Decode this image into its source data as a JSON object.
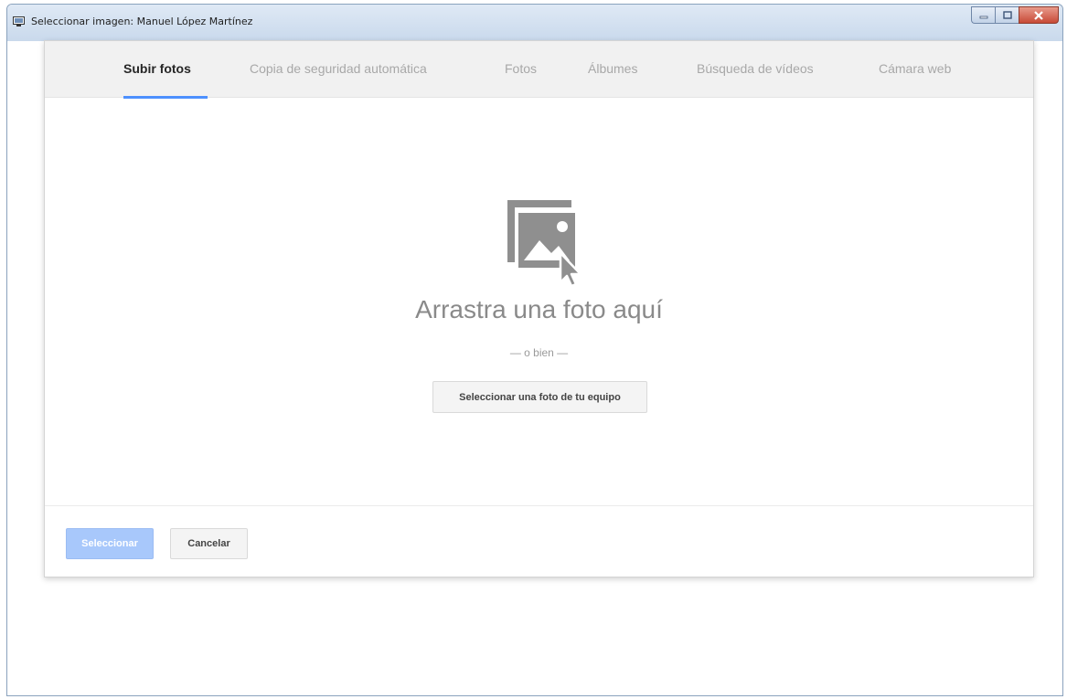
{
  "window": {
    "title": "Seleccionar imagen: Manuel López Martínez"
  },
  "tabs": [
    {
      "label": "Subir fotos",
      "active": true
    },
    {
      "label": "Copia de seguridad automática",
      "active": false
    },
    {
      "label": "Fotos",
      "active": false
    },
    {
      "label": "Álbumes",
      "active": false
    },
    {
      "label": "Búsqueda de vídeos",
      "active": false
    },
    {
      "label": "Cámara web",
      "active": false
    }
  ],
  "upload": {
    "icon": "photo-drop-icon",
    "drop_text": "Arrastra una foto aquí",
    "or_text": "— o bien —",
    "select_button": "Seleccionar una foto de tu equipo"
  },
  "footer": {
    "select_label": "Seleccionar",
    "cancel_label": "Cancelar"
  },
  "colors": {
    "accent": "#4d90fe",
    "primary_disabled": "#a8c8fb",
    "icon_gray": "#8f8f8f"
  }
}
